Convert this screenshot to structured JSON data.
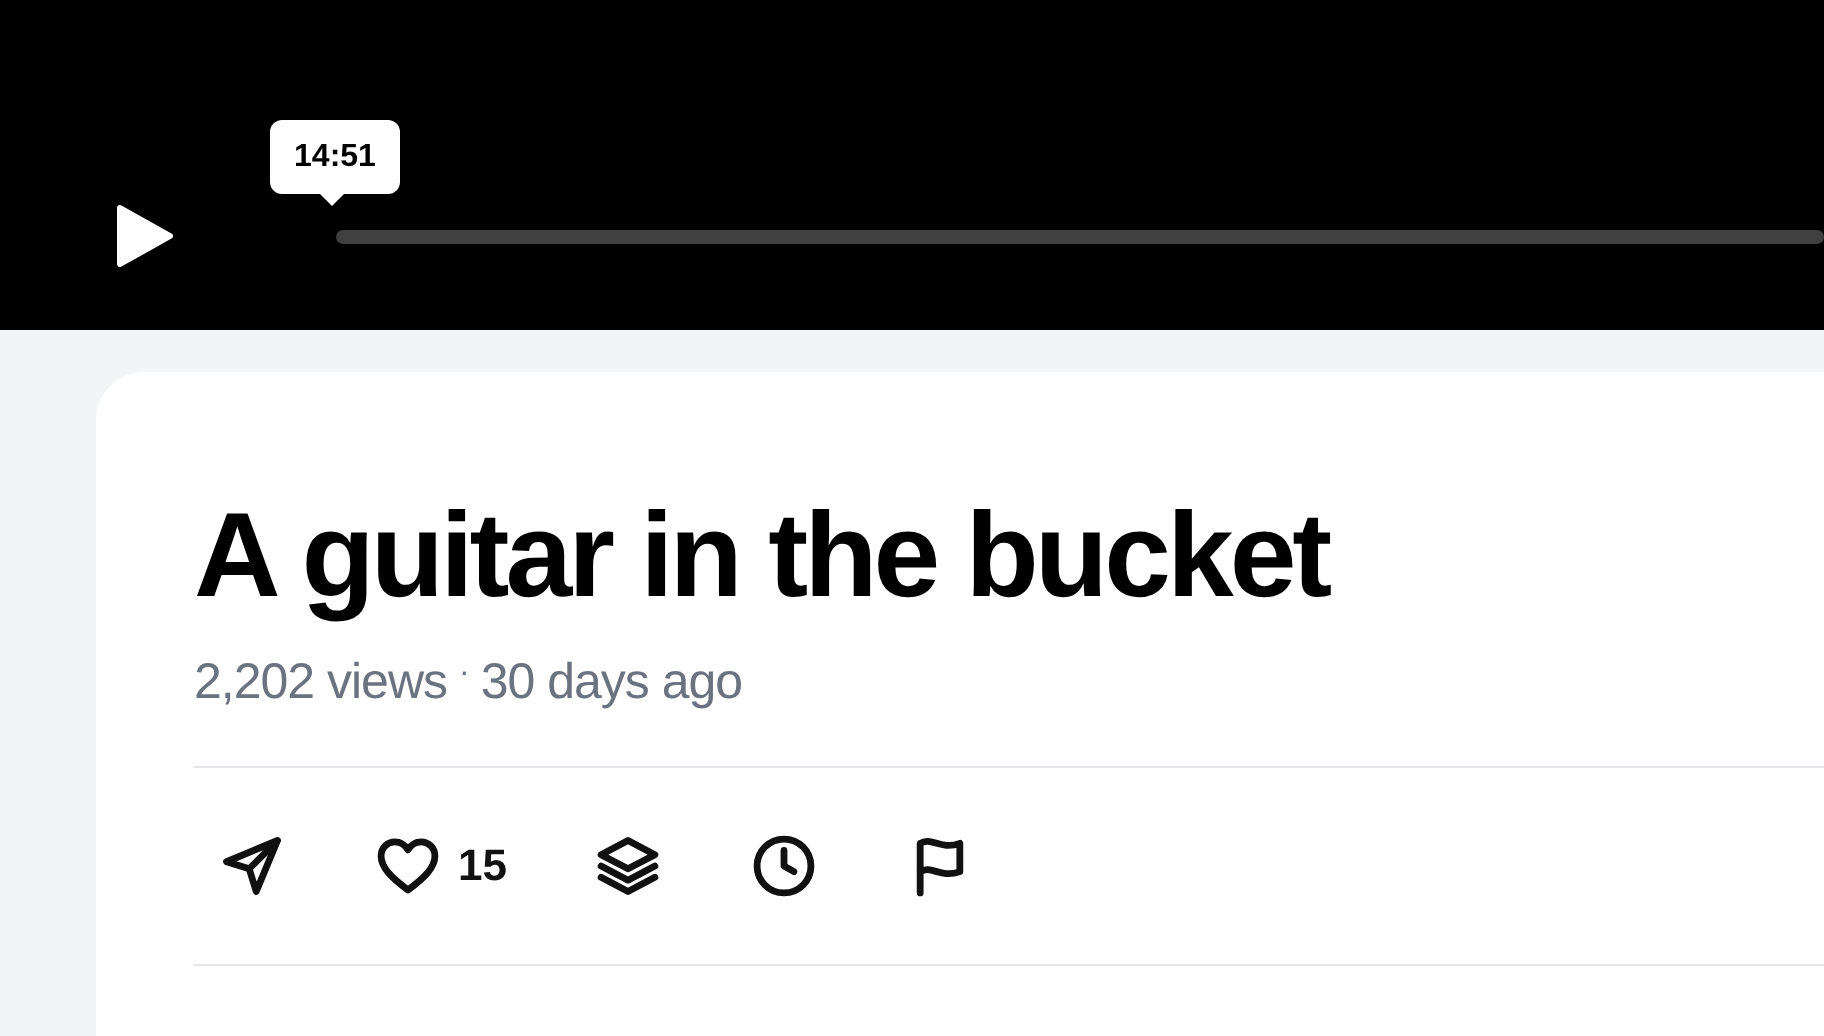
{
  "player": {
    "hover_time": "14:51"
  },
  "video": {
    "title": "A guitar in the bucket",
    "views": "2,202 views",
    "separator": "·",
    "age": "30 days ago"
  },
  "actions": [
    {
      "kind": "share"
    },
    {
      "kind": "like",
      "count": "15"
    },
    {
      "kind": "collection"
    },
    {
      "kind": "watch_later"
    },
    {
      "kind": "report"
    }
  ]
}
